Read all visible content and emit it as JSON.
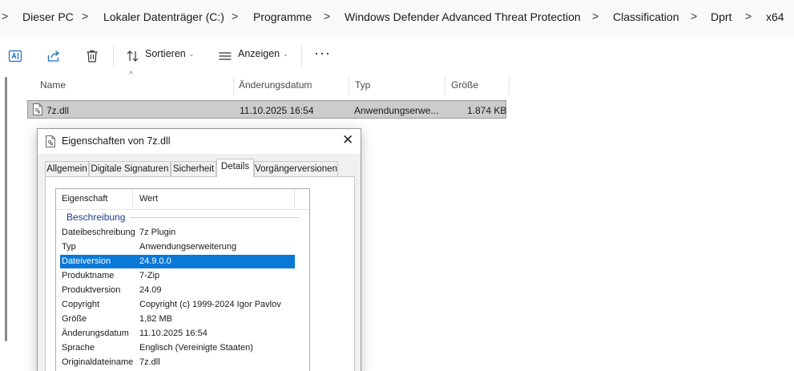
{
  "breadcrumb": {
    "items": [
      "Dieser PC",
      "Lokaler Datenträger (C:)",
      "Programme",
      "Windows Defender Advanced Threat Protection",
      "Classification",
      "Dprt",
      "x64"
    ],
    "separator": ">"
  },
  "toolbar": {
    "sort_label": "Sortieren",
    "view_label": "Anzeigen",
    "more_label": "···",
    "chevron": "⌄",
    "icons": [
      "rename-icon",
      "share-icon",
      "delete-icon",
      "sort-icon",
      "view-icon"
    ]
  },
  "filelist": {
    "columns": [
      "Name",
      "Änderungsdatum",
      "Typ",
      "Größe"
    ],
    "sort_indicator": "^",
    "rows": [
      {
        "name": "7z.dll",
        "date": "11.10.2025 16:54",
        "type": "Anwendungserwe...",
        "size": "1.874 KB"
      }
    ]
  },
  "dialog": {
    "title": "Eigenschaften von 7z.dll",
    "close": "✕",
    "tabs": [
      "Allgemein",
      "Digitale Signaturen",
      "Sicherheit",
      "Details",
      "Vorgängerversionen"
    ],
    "active_tab": "Details",
    "table": {
      "headers": [
        "Eigenschaft",
        "Wert"
      ],
      "group": "Beschreibung",
      "rows": [
        {
          "key": "Dateibeschreibung",
          "value": "7z Plugin"
        },
        {
          "key": "Typ",
          "value": "Anwendungserweiterung"
        },
        {
          "key": "Dateiversion",
          "value": "24.9.0.0",
          "selected": true
        },
        {
          "key": "Produktname",
          "value": "7-Zip"
        },
        {
          "key": "Produktversion",
          "value": "24.09"
        },
        {
          "key": "Copyright",
          "value": "Copyright (c) 1999-2024 Igor Pavlov"
        },
        {
          "key": "Größe",
          "value": "1,82 MB"
        },
        {
          "key": "Änderungsdatum",
          "value": "11.10.2025 16:54"
        },
        {
          "key": "Sprache",
          "value": "Englisch (Vereinigte Staaten)"
        },
        {
          "key": "Originaldateiname",
          "value": "7z.dll"
        }
      ]
    }
  },
  "colors": {
    "selection": "#0a78d7",
    "file_row_selection": "#cccccc",
    "group_text": "#1e3f8a",
    "toolbar_accent": "#1d6fbf"
  }
}
